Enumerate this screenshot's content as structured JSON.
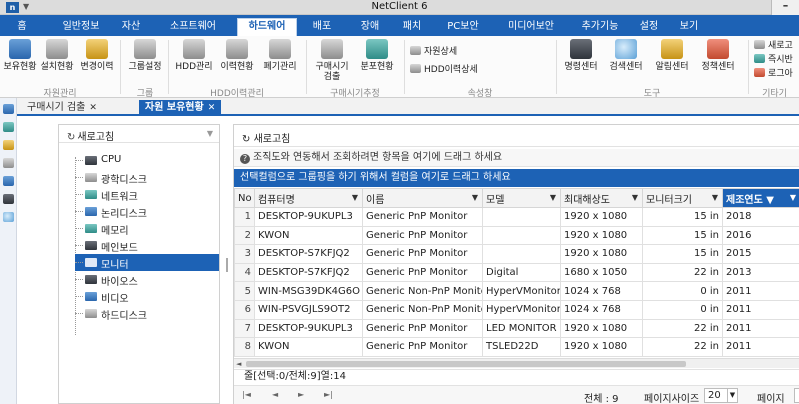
{
  "titlebar": {
    "title": "NetClient 6",
    "app_icon": "n",
    "qa": "▼",
    "minimize": "–"
  },
  "menu": {
    "tabs": [
      {
        "label": "홈"
      },
      {
        "label": "일반정보"
      },
      {
        "label": "자산"
      },
      {
        "label": "소프트웨어"
      },
      {
        "label": "하드웨어"
      },
      {
        "label": "배포"
      },
      {
        "label": "장애"
      },
      {
        "label": "패치"
      },
      {
        "label": "PC보안"
      },
      {
        "label": "미디어보안"
      },
      {
        "label": "추가기능"
      },
      {
        "label": "설정"
      },
      {
        "label": "보기"
      }
    ],
    "active": "하드웨어"
  },
  "ribbon": {
    "buttons": [
      {
        "label": "보유현황"
      },
      {
        "label": "설치현황"
      },
      {
        "label": "변경이력"
      },
      {
        "label": "그룹설정"
      },
      {
        "label": "HDD관리"
      },
      {
        "label": "이력현황"
      },
      {
        "label": "폐기관리"
      },
      {
        "label": "구매시기\n검출"
      },
      {
        "label": "분포현황"
      },
      {
        "label": "명령센터"
      },
      {
        "label": "검색센터"
      },
      {
        "label": "알림센터"
      },
      {
        "label": "정책센터"
      }
    ],
    "small": [
      {
        "label": "자원상세"
      },
      {
        "label": "HDD이력상세"
      },
      {
        "label": "새로고"
      },
      {
        "label": "즉시반"
      },
      {
        "label": "로그아"
      }
    ],
    "groups": [
      "자원관리",
      "그룹",
      "HDD이력관리",
      "구매시기추정",
      "속성창",
      "도구",
      "기타기"
    ]
  },
  "doctabs": [
    {
      "label": "구매시기 검출",
      "close": "✕",
      "active": false
    },
    {
      "label": "자원 보유현황",
      "close": "✕",
      "active": true
    }
  ],
  "tree": {
    "refresh_label": "새로고침",
    "caret": "▼",
    "items": [
      {
        "label": "CPU"
      },
      {
        "label": "광학디스크"
      },
      {
        "label": "네트워크"
      },
      {
        "label": "논리디스크"
      },
      {
        "label": "메모리"
      },
      {
        "label": "메인보드"
      },
      {
        "label": "모니터"
      },
      {
        "label": "바이오스"
      },
      {
        "label": "비디오"
      },
      {
        "label": "하드디스크"
      }
    ],
    "selected": "모니터"
  },
  "grid": {
    "refresh_label": "새로고침",
    "group_hint": "조직도와 연동해서 조회하려면 항목을 여기에 드래그 하세요",
    "drag_hint": "선택컬럼으로 그룹핑을 하기 위해서 컬럼을 여기로 드래그 하세요",
    "columns": [
      "No",
      "컴퓨터명",
      "이름",
      "모델",
      "최대해상도",
      "모니터크기",
      "제조연도"
    ],
    "filter_icon": "▼",
    "sort_icon": "▼",
    "rows": [
      {
        "no": "1",
        "computer": "DESKTOP-9UKUPL3",
        "name": "Generic PnP Monitor",
        "model": "",
        "res": "1920 x 1080",
        "size": "15 in",
        "year": "2018"
      },
      {
        "no": "2",
        "computer": "KWON",
        "name": "Generic PnP Monitor",
        "model": "",
        "res": "1920 x 1080",
        "size": "15 in",
        "year": "2016"
      },
      {
        "no": "3",
        "computer": "DESKTOP-S7KFJQ2",
        "name": "Generic PnP Monitor",
        "model": "",
        "res": "1920 x 1080",
        "size": "15 in",
        "year": "2015"
      },
      {
        "no": "4",
        "computer": "DESKTOP-S7KFJQ2",
        "name": "Generic PnP Monitor",
        "model": "Digital",
        "res": "1680 x 1050",
        "size": "22 in",
        "year": "2013"
      },
      {
        "no": "5",
        "computer": "WIN-MSG39DK4G6O",
        "name": "Generic Non-PnP Monitor",
        "model": "HyperVMonitor",
        "res": "1024 x 768",
        "size": "0 in",
        "year": "2011"
      },
      {
        "no": "6",
        "computer": "WIN-PSVGJLS9OT2",
        "name": "Generic Non-PnP Monitor",
        "model": "HyperVMonitor",
        "res": "1024 x 768",
        "size": "0 in",
        "year": "2011"
      },
      {
        "no": "7",
        "computer": "DESKTOP-9UKUPL3",
        "name": "Generic PnP Monitor",
        "model": "LED MONITOR",
        "res": "1920 x 1080",
        "size": "22 in",
        "year": "2011"
      },
      {
        "no": "8",
        "computer": "KWON",
        "name": "Generic PnP Monitor",
        "model": "TSLED22D",
        "res": "1920 x 1080",
        "size": "22 in",
        "year": "2011"
      }
    ],
    "status": "줄[선택:0/전체:9]열:14"
  },
  "pager": {
    "first": "|◄",
    "prev": "◄",
    "next": "►",
    "last": "►|",
    "total": "전체 : 9",
    "page_size_label": "페이지사이즈",
    "page_size": "20",
    "page_label": "페이지"
  },
  "colors": {
    "accent": "#1d62b5",
    "ribbon_bg": "#fbfbfb"
  }
}
